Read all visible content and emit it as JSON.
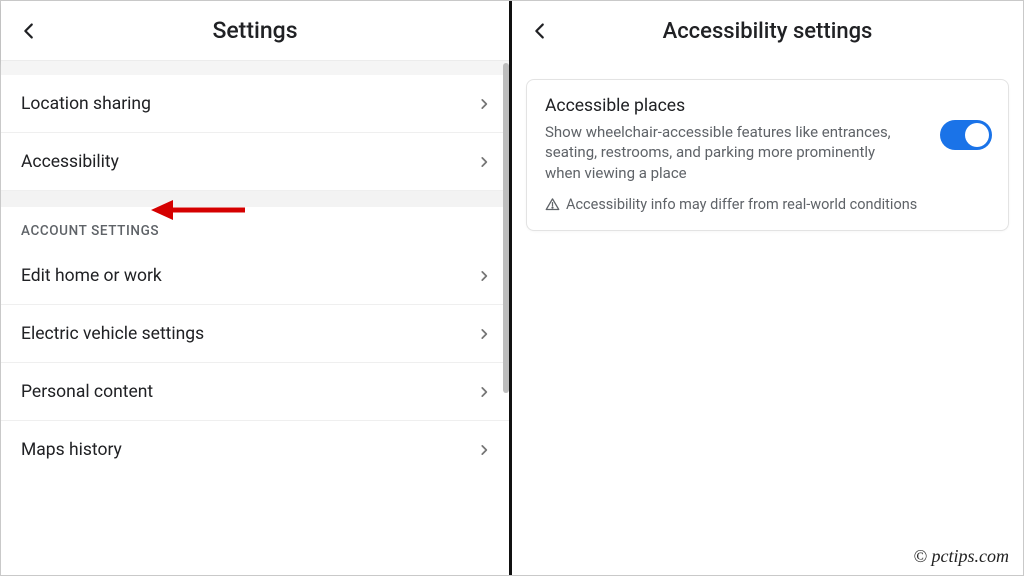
{
  "left": {
    "title": "Settings",
    "items": {
      "location_sharing": "Location sharing",
      "accessibility": "Accessibility"
    },
    "section_header": "ACCOUNT SETTINGS",
    "account_items": {
      "edit_home_work": "Edit home or work",
      "ev_settings": "Electric vehicle settings",
      "personal_content": "Personal content",
      "maps_history": "Maps history"
    }
  },
  "right": {
    "title": "Accessibility settings",
    "card": {
      "title": "Accessible places",
      "description": "Show wheelchair-accessible features like entrances, seating, restrooms, and parking more prominently when viewing a place",
      "warning": "Accessibility info may differ from real-world conditions",
      "toggle_on": true
    }
  },
  "watermark": "© pctips.com"
}
